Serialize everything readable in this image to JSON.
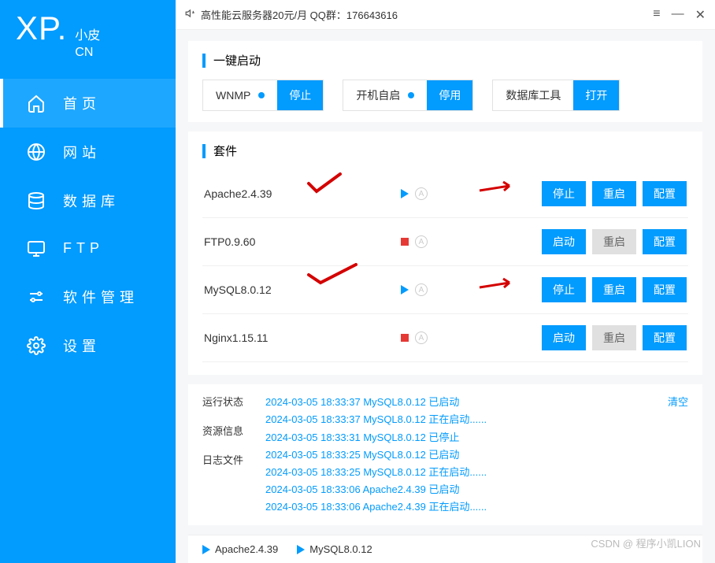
{
  "logo": {
    "xp": "XP.",
    "cn_top": "小皮",
    "cn_bottom": "CN"
  },
  "nav": [
    {
      "label": "首页",
      "icon": "home"
    },
    {
      "label": "网站",
      "icon": "globe"
    },
    {
      "label": "数据库",
      "icon": "database"
    },
    {
      "label": "FTP",
      "icon": "monitor"
    },
    {
      "label": "软件管理",
      "icon": "sliders"
    },
    {
      "label": "设置",
      "icon": "gear"
    }
  ],
  "titlebar": {
    "announce": "高性能云服务器20元/月   QQ群：176643616"
  },
  "quickstart": {
    "title": "一键启动",
    "items": [
      {
        "label": "WNMP",
        "dot": true,
        "btn": "停止"
      },
      {
        "label": "开机自启",
        "dot": true,
        "btn": "停用"
      },
      {
        "label": "数据库工具",
        "dot": false,
        "btn": "打开"
      }
    ]
  },
  "suite": {
    "title": "套件",
    "rows": [
      {
        "name": "Apache2.4.39",
        "running": true,
        "btns": [
          "停止",
          "重启",
          "配置"
        ],
        "disabled": []
      },
      {
        "name": "FTP0.9.60",
        "running": false,
        "btns": [
          "启动",
          "重启",
          "配置"
        ],
        "disabled": [
          1
        ]
      },
      {
        "name": "MySQL8.0.12",
        "running": true,
        "btns": [
          "停止",
          "重启",
          "配置"
        ],
        "disabled": []
      },
      {
        "name": "Nginx1.15.11",
        "running": false,
        "btns": [
          "启动",
          "重启",
          "配置"
        ],
        "disabled": [
          1
        ]
      }
    ]
  },
  "logs": {
    "tabs": [
      "运行状态",
      "资源信息",
      "日志文件"
    ],
    "clear": "清空",
    "lines": [
      "2024-03-05 18:33:37 MySQL8.0.12 已启动",
      "2024-03-05 18:33:37 MySQL8.0.12 正在启动......",
      "2024-03-05 18:33:31 MySQL8.0.12 已停止",
      "2024-03-05 18:33:25 MySQL8.0.12 已启动",
      "2024-03-05 18:33:25 MySQL8.0.12 正在启动......",
      "2024-03-05 18:33:06 Apache2.4.39 已启动",
      "2024-03-05 18:33:06 Apache2.4.39 正在启动......"
    ]
  },
  "statusbar": {
    "items": [
      "Apache2.4.39",
      "MySQL8.0.12"
    ]
  },
  "watermark": "CSDN @ 程序小凯LION"
}
